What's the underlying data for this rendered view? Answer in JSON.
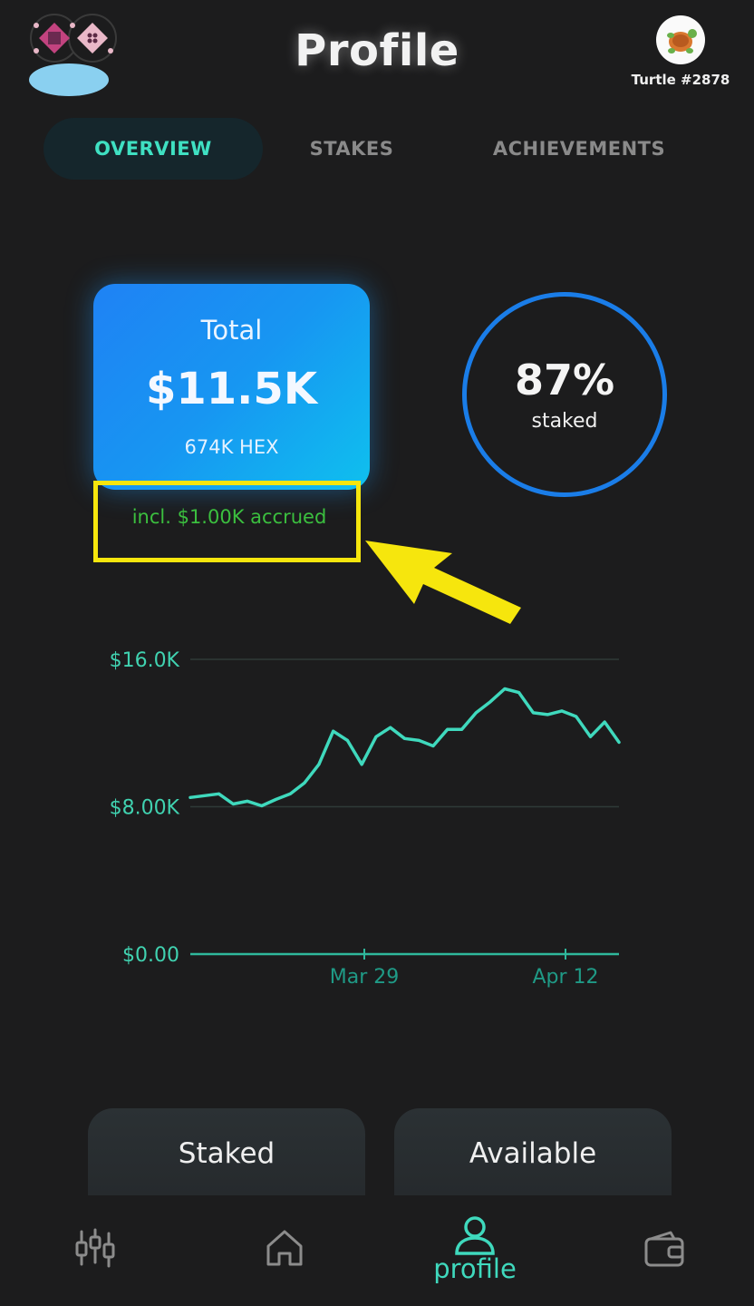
{
  "header": {
    "title": "Profile",
    "user_name": "Turtle #2878",
    "avatar_icon": "turtle-icon",
    "logo_icon": "pixel-logo-icon"
  },
  "tabs": [
    {
      "label": "OVERVIEW",
      "active": true
    },
    {
      "label": "STAKES",
      "active": false
    },
    {
      "label": "ACHIEVEMENTS",
      "active": false
    }
  ],
  "summary": {
    "total_label": "Total",
    "total_value": "$11.5K",
    "total_hex": "674K HEX",
    "accrued_text": "incl. $1.00K accrued",
    "staked_percent": "87%",
    "staked_label": "staked"
  },
  "chart_data": {
    "type": "line",
    "y_ticks": [
      "$16.0K",
      "$8.00K",
      "$0.00"
    ],
    "x_ticks": [
      "Mar 29",
      "Apr 12"
    ],
    "ylim": [
      0,
      16000
    ],
    "grid": true,
    "series": [
      {
        "values": [
          8500,
          8600,
          8700,
          8150,
          8300,
          8050,
          8400,
          8700,
          9300,
          10300,
          12100,
          11600,
          10300,
          11800,
          12300,
          11700,
          11600,
          11300,
          12200,
          12200,
          13100,
          13700,
          14400,
          14200,
          13100,
          13000,
          13200,
          12900,
          11800,
          12600,
          11500
        ]
      }
    ],
    "color": "#3fd9bd"
  },
  "cards": {
    "staked_label": "Staked",
    "available_label": "Available"
  },
  "nav": {
    "items": [
      {
        "icon": "market-candles-icon"
      },
      {
        "icon": "home-icon"
      },
      {
        "icon": "profile-icon",
        "label": "profile",
        "active": true
      },
      {
        "icon": "wallet-icon"
      }
    ]
  },
  "colors": {
    "accent": "#3fd9bd",
    "card_blue": "#1f82f4",
    "ring_blue": "#1a7de8",
    "accrued_green": "#3bbf3f",
    "highlight_yellow": "#f6e60d"
  }
}
